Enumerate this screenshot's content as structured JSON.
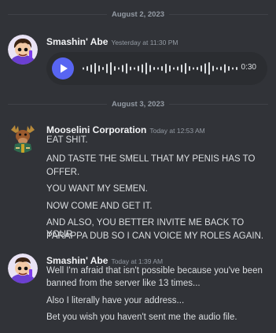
{
  "dividers": [
    "August 2, 2023",
    "August 3, 2023"
  ],
  "messages": [
    {
      "author": "Smashin' Abe",
      "timestamp": "Yesterday at 11:30 PM",
      "attachment": {
        "type": "voice-message",
        "duration": "0:30"
      }
    },
    {
      "author": "Mooselini Corporation",
      "timestamp": "Today at 12:53 AM",
      "lines": [
        "EAT SHIT.",
        "AND TASTE THE SMELL THAT MY PENIS HAS TO",
        "OFFER.",
        "YOU WANT MY SEMEN.",
        "NOW COME AND GET IT.",
        "AND ALSO, YOU BETTER INVITE ME BACK TO YOUR",
        "PARAPPA DUB SO I CAN VOICE MY ROLES AGAIN."
      ]
    },
    {
      "author": "Smashin' Abe",
      "timestamp": "Today at 1:39 AM",
      "lines": [
        "Well I'm afraid that isn't possible because you've been",
        "banned from the server like 13 times...",
        "Also I literally have your address...",
        "Bet you wish you haven't sent me the audio file."
      ]
    }
  ],
  "colors": {
    "background": "#313338",
    "accent": "#5865f2",
    "text": "#dbdee1",
    "muted": "#949ba4"
  },
  "icons": {
    "play": "play-icon",
    "waveform": "waveform-icon"
  }
}
